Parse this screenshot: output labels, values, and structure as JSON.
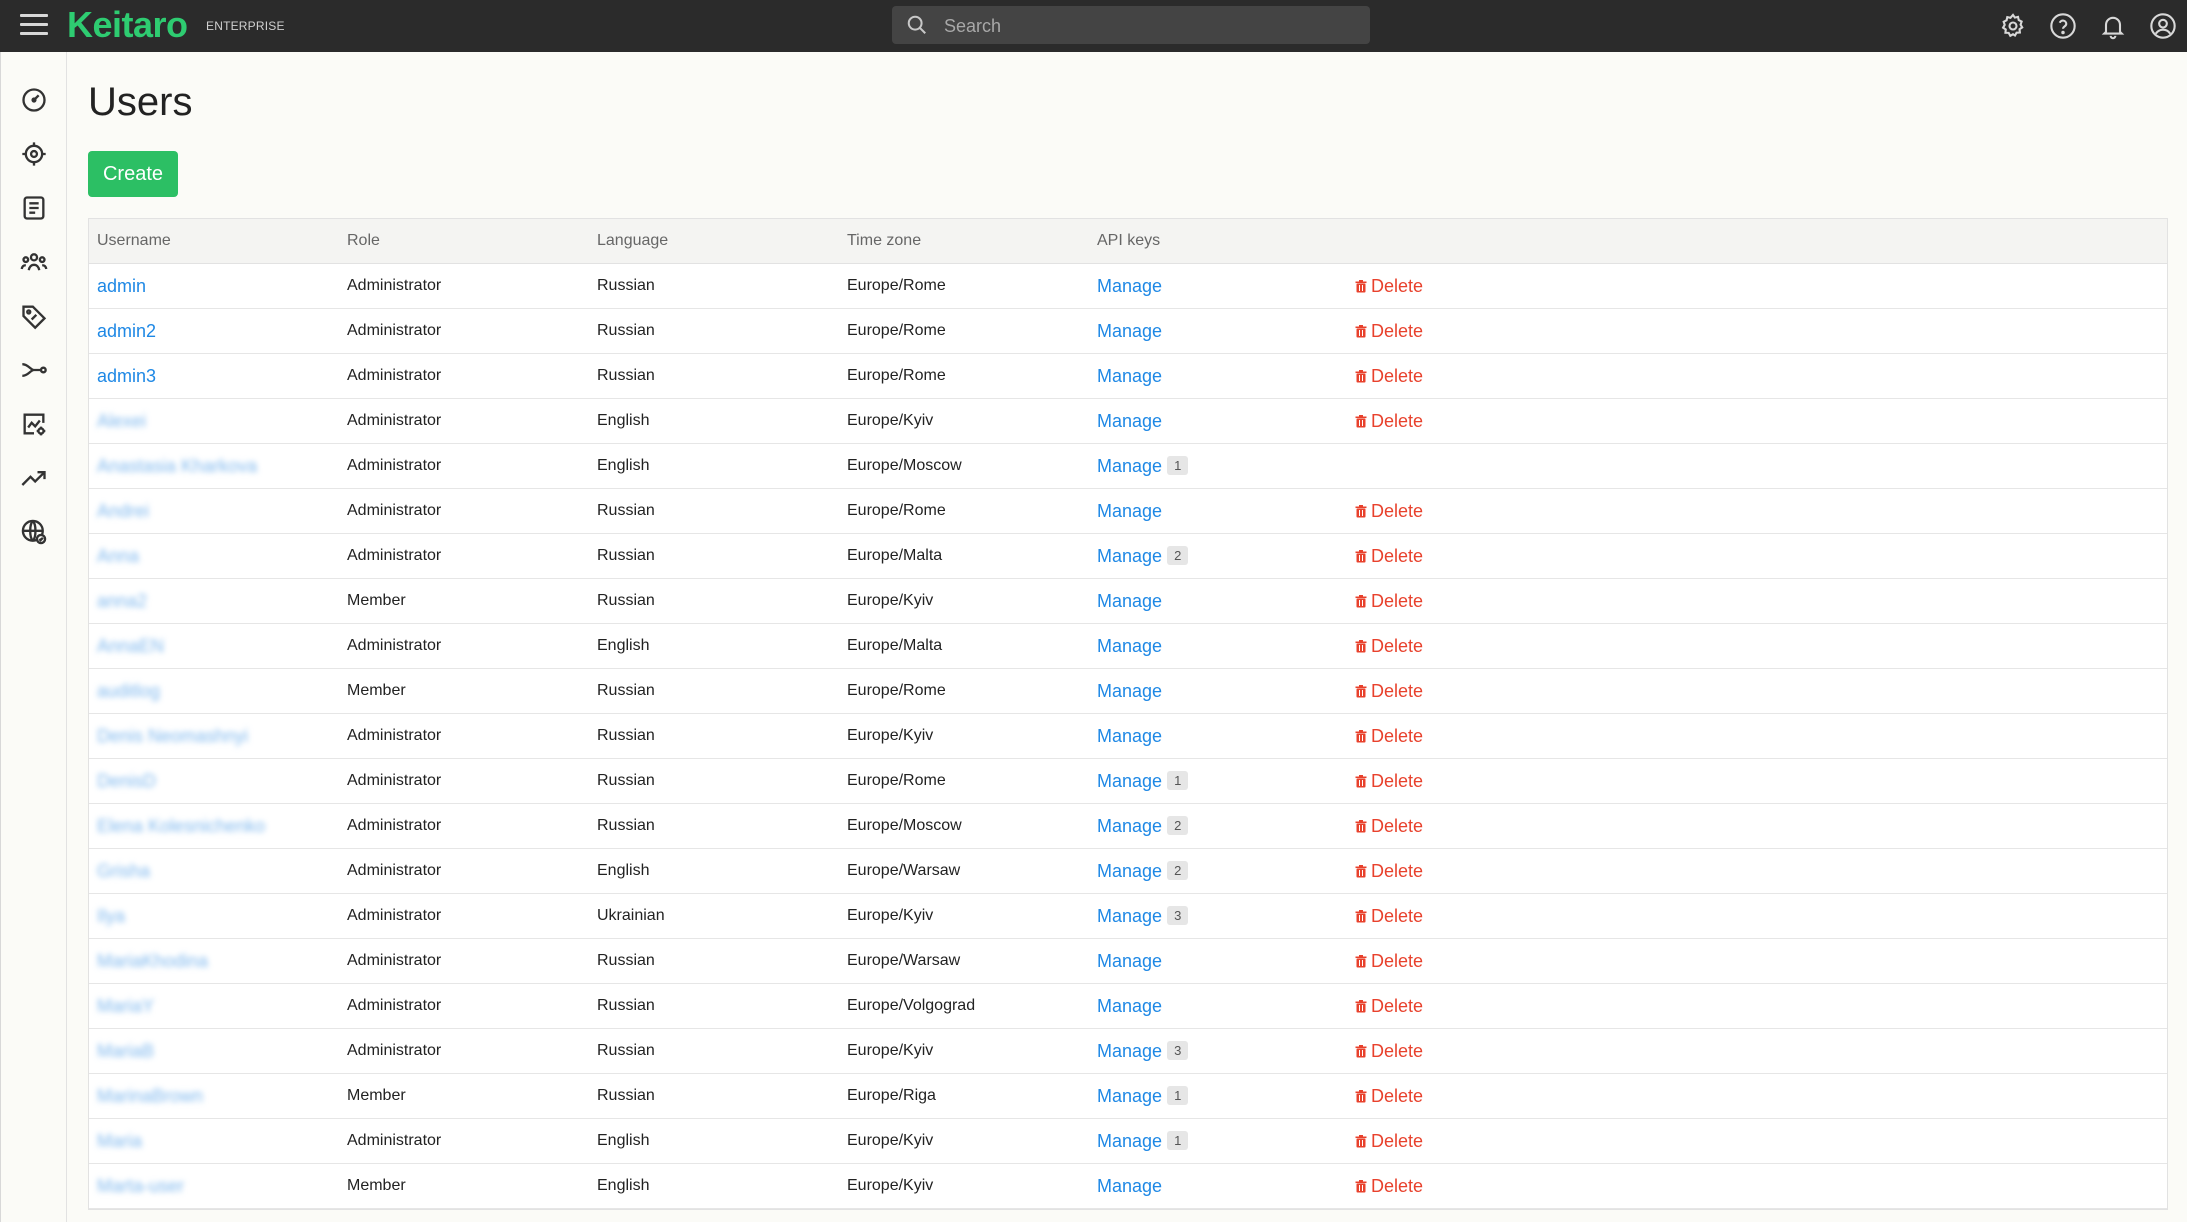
{
  "app": {
    "logo": "Keitaro",
    "edition": "ENTERPRISE"
  },
  "search": {
    "placeholder": "Search",
    "value": ""
  },
  "topbar_icons": [
    "settings-icon",
    "help-icon",
    "bell-icon",
    "account-icon"
  ],
  "sidebar_icons": [
    "dashboard-icon",
    "campaigns-icon",
    "offers-icon",
    "users-icon",
    "tags-icon",
    "flows-icon",
    "reports-icon",
    "trends-icon",
    "domains-icon"
  ],
  "page": {
    "title": "Users",
    "create_label": "Create"
  },
  "table": {
    "headers": {
      "username": "Username",
      "role": "Role",
      "language": "Language",
      "timezone": "Time zone",
      "api_keys": "API keys"
    },
    "manage_label": "Manage",
    "delete_label": "Delete",
    "rows": [
      {
        "username": "admin",
        "blurred": false,
        "role": "Administrator",
        "language": "Russian",
        "timezone": "Europe/Rome",
        "keys": "",
        "deletable": true
      },
      {
        "username": "admin2",
        "blurred": false,
        "role": "Administrator",
        "language": "Russian",
        "timezone": "Europe/Rome",
        "keys": "",
        "deletable": true
      },
      {
        "username": "admin3",
        "blurred": false,
        "role": "Administrator",
        "language": "Russian",
        "timezone": "Europe/Rome",
        "keys": "",
        "deletable": true
      },
      {
        "username": "Alexei",
        "blurred": true,
        "role": "Administrator",
        "language": "English",
        "timezone": "Europe/Kyiv",
        "keys": "",
        "deletable": true
      },
      {
        "username": "Anastasia Kharkova",
        "blurred": true,
        "role": "Administrator",
        "language": "English",
        "timezone": "Europe/Moscow",
        "keys": "1",
        "deletable": false
      },
      {
        "username": "Andrei",
        "blurred": true,
        "role": "Administrator",
        "language": "Russian",
        "timezone": "Europe/Rome",
        "keys": "",
        "deletable": true
      },
      {
        "username": "Anna",
        "blurred": true,
        "role": "Administrator",
        "language": "Russian",
        "timezone": "Europe/Malta",
        "keys": "2",
        "deletable": true
      },
      {
        "username": "anna2",
        "blurred": true,
        "role": "Member",
        "language": "Russian",
        "timezone": "Europe/Kyiv",
        "keys": "",
        "deletable": true
      },
      {
        "username": "AnnaEN",
        "blurred": true,
        "role": "Administrator",
        "language": "English",
        "timezone": "Europe/Malta",
        "keys": "",
        "deletable": true
      },
      {
        "username": "auditlog",
        "blurred": true,
        "role": "Member",
        "language": "Russian",
        "timezone": "Europe/Rome",
        "keys": "",
        "deletable": true
      },
      {
        "username": "Denis Neomashnyi",
        "blurred": true,
        "role": "Administrator",
        "language": "Russian",
        "timezone": "Europe/Kyiv",
        "keys": "",
        "deletable": true
      },
      {
        "username": "DenisD",
        "blurred": true,
        "role": "Administrator",
        "language": "Russian",
        "timezone": "Europe/Rome",
        "keys": "1",
        "deletable": true
      },
      {
        "username": "Elena Kolesnichenko",
        "blurred": true,
        "role": "Administrator",
        "language": "Russian",
        "timezone": "Europe/Moscow",
        "keys": "2",
        "deletable": true
      },
      {
        "username": "Grisha",
        "blurred": true,
        "role": "Administrator",
        "language": "English",
        "timezone": "Europe/Warsaw",
        "keys": "2",
        "deletable": true
      },
      {
        "username": "Ilya",
        "blurred": true,
        "role": "Administrator",
        "language": "Ukrainian",
        "timezone": "Europe/Kyiv",
        "keys": "3",
        "deletable": true
      },
      {
        "username": "MariaKhodina",
        "blurred": true,
        "role": "Administrator",
        "language": "Russian",
        "timezone": "Europe/Warsaw",
        "keys": "",
        "deletable": true
      },
      {
        "username": "MariaY",
        "blurred": true,
        "role": "Administrator",
        "language": "Russian",
        "timezone": "Europe/Volgograd",
        "keys": "",
        "deletable": true
      },
      {
        "username": "MariaB",
        "blurred": true,
        "role": "Administrator",
        "language": "Russian",
        "timezone": "Europe/Kyiv",
        "keys": "3",
        "deletable": true
      },
      {
        "username": "MarinaBrown",
        "blurred": true,
        "role": "Member",
        "language": "Russian",
        "timezone": "Europe/Riga",
        "keys": "1",
        "deletable": true
      },
      {
        "username": "Maria",
        "blurred": true,
        "role": "Administrator",
        "language": "English",
        "timezone": "Europe/Kyiv",
        "keys": "1",
        "deletable": true
      },
      {
        "username": "Marta-user",
        "blurred": true,
        "role": "Member",
        "language": "English",
        "timezone": "Europe/Kyiv",
        "keys": "",
        "deletable": true
      }
    ]
  }
}
